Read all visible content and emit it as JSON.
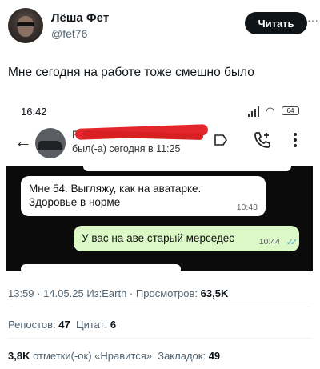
{
  "tweet": {
    "author": {
      "name": "Лёша Фет",
      "handle": "@fet76"
    },
    "follow_label": "Читать",
    "more_label": "···",
    "text": "Мне сегодня на работе тоже смешно было"
  },
  "screenshot": {
    "status_time": "16:42",
    "battery": "64",
    "chat_header": {
      "name_visible": "E",
      "last_seen": "был(-а) сегодня в 11:25"
    },
    "messages": [
      {
        "direction": "in",
        "text": "Мне 54. Выгляжу, как на аватарке. Здоровье в норме",
        "time": "10:43"
      },
      {
        "direction": "out",
        "text": "У вас на аве старый мерседес",
        "time": "10:44",
        "ticks": "✓✓"
      }
    ]
  },
  "meta": {
    "time": "13:59",
    "date": "14.05.25",
    "source": "Из:Earth",
    "views_label": "Просмотров:",
    "views": "63,5K"
  },
  "stats": {
    "reposts_label": "Репостов:",
    "reposts": "47",
    "quotes_label": "Цитат:",
    "quotes": "6",
    "likes": "3,8K",
    "likes_label": "отметки(-ок) «Нравится»",
    "bookmarks_label": "Закладок:",
    "bookmarks": "49"
  },
  "colors": {
    "accent_dark": "#0f1419",
    "muted": "#536471",
    "outgoing_bubble": "#dcf8c6",
    "redaction": "#e2262a",
    "read_ticks": "#3b9bd6"
  }
}
